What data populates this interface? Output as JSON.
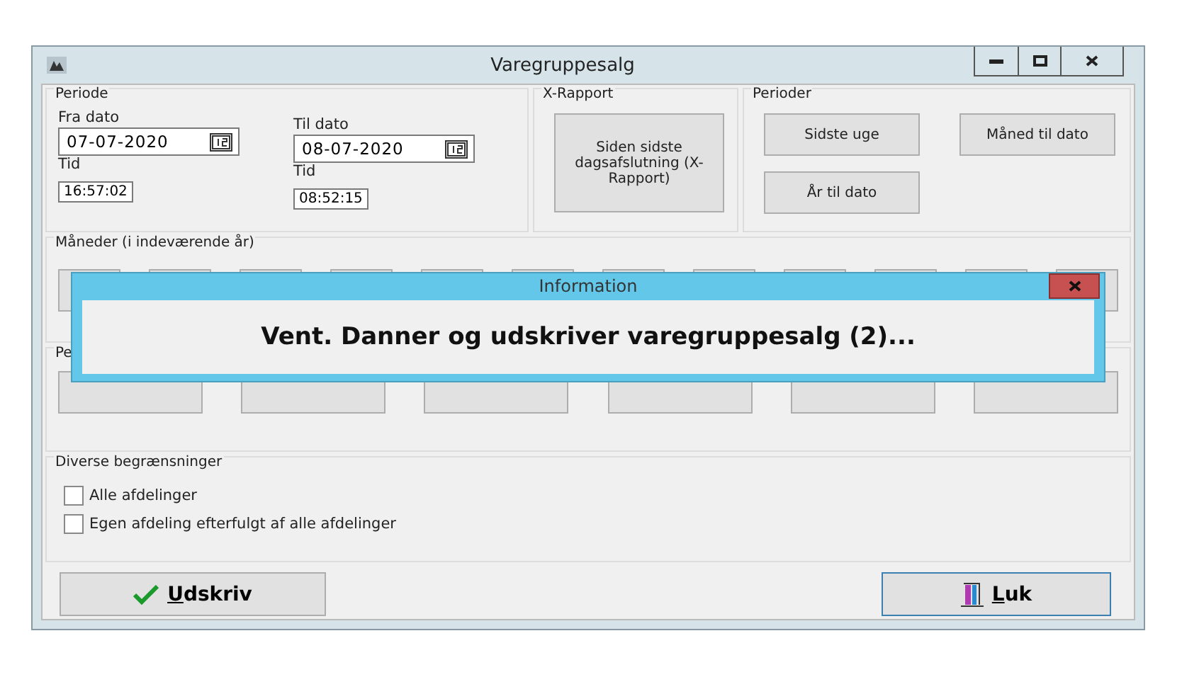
{
  "window": {
    "title": "Varegruppesalg"
  },
  "periode": {
    "title": "Periode",
    "from_label": "Fra dato",
    "from_date": "07-07-2020",
    "from_time_label": "Tid",
    "from_time": "16:57:02",
    "to_label": "Til dato",
    "to_date": "08-07-2020",
    "to_time_label": "Tid",
    "to_time": "08:52:15"
  },
  "x_rapport": {
    "title": "X-Rapport",
    "button": "Siden sidste dagsafslutning (X-Rapport)"
  },
  "perioder": {
    "title": "Perioder",
    "buttons": [
      "Sidste uge",
      "Måned til dato",
      "År til dato"
    ]
  },
  "months": {
    "title": "Måneder (i indeværende år)"
  },
  "periods_section": {
    "title": "Pe"
  },
  "diverse": {
    "title": "Diverse begrænsninger",
    "options": [
      {
        "label": "Alle afdelinger",
        "checked": false
      },
      {
        "label": "Egen afdeling efterfulgt af alle afdelinger",
        "checked": false
      }
    ]
  },
  "footer": {
    "print_button": "Udskriv",
    "close_button": "Luk"
  },
  "dialog": {
    "title": "Information",
    "message": "Vent. Danner og udskriver varegruppesalg (2)..."
  }
}
